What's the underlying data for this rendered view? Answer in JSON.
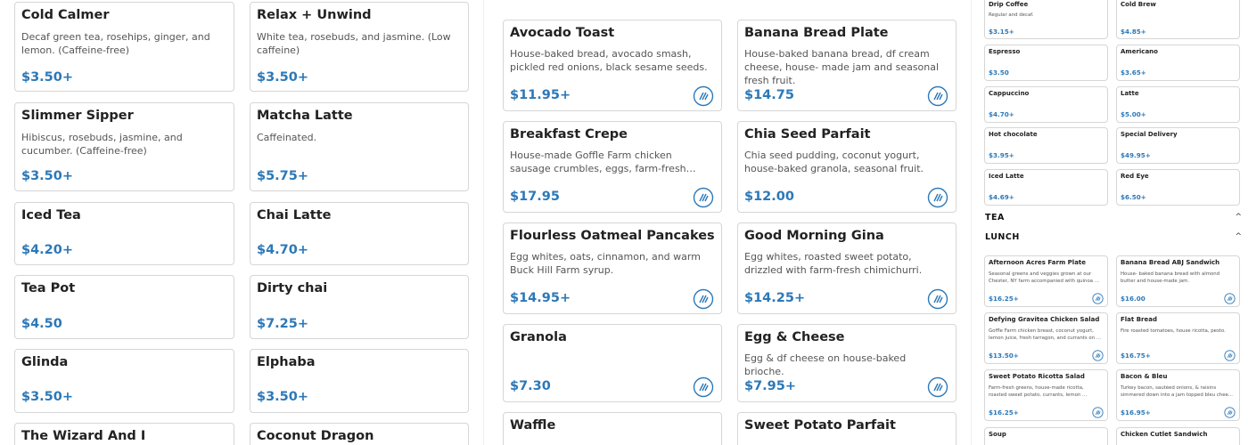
{
  "tea_column": [
    {
      "title": "Cold Calmer",
      "desc": "Decaf green tea, rosehips, ginger, and lemon. (Caffeine-free)",
      "price": "$3.50+"
    },
    {
      "title": "Relax + Unwind",
      "desc": "White tea, rosebuds, and jasmine. (Low caffeine)",
      "price": "$3.50+"
    },
    {
      "title": "Slimmer Sipper",
      "desc": "Hibiscus, rosebuds, jasmine, and cucumber. (Caffeine-free)",
      "price": "$3.50+"
    },
    {
      "title": "Matcha Latte",
      "desc": "Caffeinated.",
      "price": "$5.75+"
    },
    {
      "title": "Iced Tea",
      "desc": "",
      "price": "$4.20+"
    },
    {
      "title": "Chai Latte",
      "desc": "",
      "price": "$4.70+"
    },
    {
      "title": "Tea Pot",
      "desc": "",
      "price": "$4.50"
    },
    {
      "title": "Dirty chai",
      "desc": "",
      "price": "$7.25+"
    },
    {
      "title": "Glinda",
      "desc": "",
      "price": "$3.50+"
    },
    {
      "title": "Elphaba",
      "desc": "",
      "price": "$3.50+"
    },
    {
      "title": "The Wizard And I",
      "desc": "",
      "price": ""
    },
    {
      "title": "Coconut Dragon",
      "desc": "",
      "price": ""
    }
  ],
  "breakfast_column": [
    {
      "title": "Avocado Toast",
      "desc": "House-baked bread, avocado smash, pickled red onions, black sesame seeds.",
      "price": "$11.95+"
    },
    {
      "title": "Banana Bread Plate",
      "desc": "House-baked banana bread, df cream cheese, house- made jam and seasonal fresh fruit.",
      "price": "$14.75"
    },
    {
      "title": "Breakfast Crepe",
      "desc": "House-made Goffle Farm chicken sausage crumbles, eggs, farm-fresh spinach, df cheddar.",
      "price": "$17.95"
    },
    {
      "title": "Chia Seed Parfait",
      "desc": "Chia seed pudding, coconut yogurt, house-baked granola, seasonal fruit.",
      "price": "$12.00"
    },
    {
      "title": "Flourless Oatmeal Pancakes",
      "desc": "Egg whites, oats, cinnamon, and warm Buck Hill Farm syrup.",
      "price": "$14.95+"
    },
    {
      "title": "Good Morning Gina",
      "desc": "Egg whites, roasted sweet potato, drizzled with farm-fresh chimichurri.",
      "price": "$14.25+"
    },
    {
      "title": "Granola",
      "desc": "",
      "price": "$7.30"
    },
    {
      "title": "Egg & Cheese",
      "desc": "Egg & df cheese on house-baked brioche.",
      "price": "$7.95+"
    },
    {
      "title": "Waffle",
      "desc": "",
      "price": ""
    },
    {
      "title": "Sweet Potato Parfait",
      "desc": "",
      "price": ""
    }
  ],
  "drinks_column": [
    {
      "title": "Drip Coffee",
      "desc": "Regular and decaf.",
      "price": "$3.15+"
    },
    {
      "title": "Cold Brew",
      "desc": "",
      "price": "$4.85+"
    },
    {
      "title": "Espresso",
      "desc": "",
      "price": "$3.50"
    },
    {
      "title": "Americano",
      "desc": "",
      "price": "$3.65+"
    },
    {
      "title": "Cappuccino",
      "desc": "",
      "price": "$4.70+"
    },
    {
      "title": "Latte",
      "desc": "",
      "price": "$5.00+"
    },
    {
      "title": "Hot chocolate",
      "desc": "",
      "price": "$3.95+"
    },
    {
      "title": "Special Delivery",
      "desc": "",
      "price": "$49.95+"
    },
    {
      "title": "Iced Latte",
      "desc": "",
      "price": "$4.69+"
    },
    {
      "title": "Red Eye",
      "desc": "",
      "price": "$6.50+"
    }
  ],
  "sections": {
    "tea_label": "TEA",
    "lunch_label": "LUNCH",
    "chevron": "^"
  },
  "lunch_column": [
    {
      "title": "Afternoon Acres Farm Plate",
      "desc": "Seasonal greens and veggies grown at our Chester, NY farm accompanied with quinoa ...",
      "price": "$16.25+"
    },
    {
      "title": "Banana Bread ABJ Sandwich",
      "desc": "House- baked banana bread with almond butter and house-made jam.",
      "price": "$16.00"
    },
    {
      "title": "Defying Gravitea Chicken Salad",
      "desc": "Goffle Farm chicken breast, coconut yogurt, lemon juice, fresh tarragon, and currants on ...",
      "price": "$13.50+"
    },
    {
      "title": "Flat Bread",
      "desc": "Fire roasted tomatoes, house ricotta, pesto.",
      "price": "$16.75+"
    },
    {
      "title": "Sweet Potato Ricotta Salad",
      "desc": "Farm-fresh greens, house-made ricotta, roasted sweet potato, currants, lemon ...",
      "price": "$16.25+"
    },
    {
      "title": "Bacon & Bleu",
      "desc": "Turkey bacon, sautéed onions, & raisins simmered down into a jam topped bleu chee...",
      "price": "$16.95+"
    },
    {
      "title": "Soup",
      "desc": "",
      "price": ""
    },
    {
      "title": "Chicken Cutlet Sandwich",
      "desc": "",
      "price": ""
    }
  ],
  "colors": {
    "price": "#2c78b8",
    "border": "#d6d6d6",
    "dashpass_icon": "#2c78b8"
  },
  "icons": {
    "dashpass": "dashpass-icon"
  }
}
